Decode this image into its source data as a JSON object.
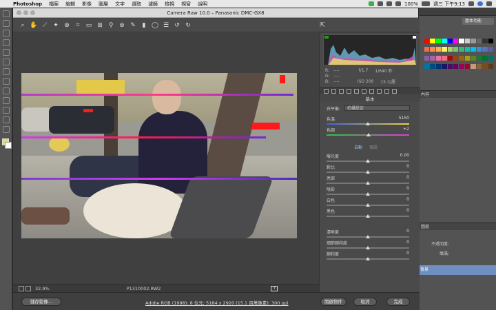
{
  "menubar": {
    "app": "Photoshop",
    "items": [
      "檔案",
      "編輯",
      "影像",
      "圖層",
      "文字",
      "選取",
      "濾鏡",
      "檢視",
      "視窗",
      "說明"
    ],
    "battery": "100%",
    "clock": "週三 下午9:13"
  },
  "camera_raw": {
    "title": "Camera Raw 10.0  –  Panasonic DMC-GX8",
    "zoom": "32.9%",
    "filename": "P1310002.RW2",
    "workflow": "Adobe RGB (1998); 8 位元; 5184 x 2920 (15.1 百萬像素); 300 ppi",
    "buttons": {
      "save": "儲存影像...",
      "open": "開啟物件",
      "cancel": "取消",
      "done": "完成"
    },
    "meta": {
      "r": "R:",
      "g": "G:",
      "b": "B:",
      "r_val": "----",
      "g_val": "----",
      "b_val": "----",
      "aperture": "f/1.7",
      "shutter": "1/640 秒",
      "iso": "ISO 200",
      "focal": "15 公厘"
    },
    "panel_title": "基本",
    "white_balance": {
      "label": "白平衡:",
      "value": "拍攝設定"
    },
    "auto_links": [
      "自動",
      "預設"
    ],
    "sliders": [
      {
        "label": "色溫",
        "value": "5150",
        "pos": 0.5
      },
      {
        "label": "色調",
        "value": "+2",
        "pos": 0.51
      },
      {
        "label": "曝光度",
        "value": "0.00",
        "pos": 0.5
      },
      {
        "label": "對比",
        "value": "0",
        "pos": 0.5
      },
      {
        "label": "亮部",
        "value": "0",
        "pos": 0.5
      },
      {
        "label": "陰影",
        "value": "0",
        "pos": 0.5
      },
      {
        "label": "白色",
        "value": "0",
        "pos": 0.5
      },
      {
        "label": "黑色",
        "value": "0",
        "pos": 0.5
      },
      {
        "label": "清晰度",
        "value": "0",
        "pos": 0.5
      },
      {
        "label": "細節飽和度",
        "value": "0",
        "pos": 0.5
      },
      {
        "label": "飽和度",
        "value": "0",
        "pos": 0.5
      }
    ]
  },
  "photoshop_right": {
    "workspace": "基本功能",
    "panels": [
      "內容",
      "圖層"
    ],
    "opacity_label": "不透明度:",
    "fill_label": "填滿:",
    "layer_name": "背景"
  },
  "colors": {
    "accent_blue": "#4a78c9",
    "clip_red": "#ff1a1a",
    "clip_magenta": "#d23cf0"
  }
}
